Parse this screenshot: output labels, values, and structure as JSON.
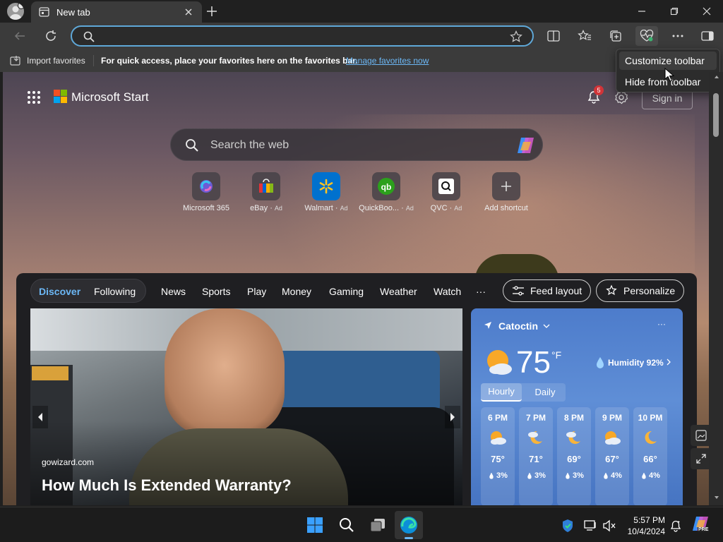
{
  "tab": {
    "title": "New tab"
  },
  "address": {
    "value": "",
    "placeholder": ""
  },
  "favorites_bar": {
    "import_label": "Import favorites",
    "hint": "For quick access, place your favorites here on the favorites bar.",
    "manage_link": "Manage favorites now"
  },
  "context_menu": {
    "items": [
      "Customize toolbar",
      "Hide from toolbar"
    ]
  },
  "page": {
    "brand": "Microsoft Start",
    "notifications_count": "5",
    "sign_in": "Sign in",
    "search_placeholder": "Search the web",
    "shortcuts": [
      {
        "label": "Microsoft 365",
        "ad": ""
      },
      {
        "label": "eBay",
        "ad": "Ad"
      },
      {
        "label": "Walmart",
        "ad": "Ad"
      },
      {
        "label": "QuickBoo...",
        "ad": "Ad"
      },
      {
        "label": "QVC",
        "ad": "Ad"
      },
      {
        "label": "Add shortcut",
        "ad": ""
      }
    ],
    "feed_tabs": {
      "discover": "Discover",
      "following": "Following",
      "items": [
        "News",
        "Sports",
        "Play",
        "Money",
        "Gaming",
        "Weather",
        "Watch"
      ],
      "more": "···"
    },
    "feed_layout": "Feed layout",
    "personalize": "Personalize",
    "article": {
      "source": "gowizard.com",
      "title": "How Much Is Extended Warranty?"
    },
    "weather": {
      "location": "Catoctin",
      "temp": "75",
      "unit": "°F",
      "humidity": "Humidity 92%",
      "tabs": [
        "Hourly",
        "Daily"
      ],
      "hours": [
        {
          "time": "6 PM",
          "temp": "75°",
          "precip": "3%"
        },
        {
          "time": "7 PM",
          "temp": "71°",
          "precip": "3%"
        },
        {
          "time": "8 PM",
          "temp": "69°",
          "precip": "3%"
        },
        {
          "time": "9 PM",
          "temp": "67°",
          "precip": "4%"
        },
        {
          "time": "10 PM",
          "temp": "66°",
          "precip": "4%"
        }
      ]
    }
  },
  "taskbar": {
    "time": "5:57 PM",
    "date": "10/4/2024",
    "copilot_badge": "PRE"
  },
  "colors": {
    "accent_link": "#6cb8f6",
    "address_focus": "#5fa8d8",
    "weather_bg": "#5f8ed6",
    "badge_red": "#d13438"
  }
}
